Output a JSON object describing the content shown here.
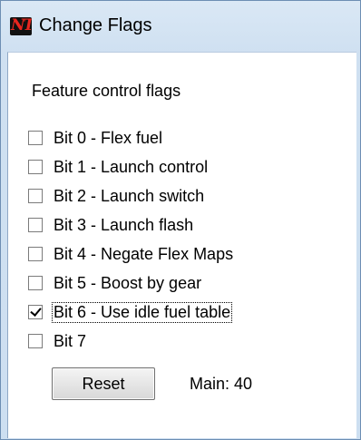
{
  "window": {
    "title": "Change Flags",
    "app_icon_text": "NT"
  },
  "panel": {
    "section_title": "Feature control flags",
    "flags": [
      {
        "label": "Bit 0 - Flex fuel",
        "checked": false
      },
      {
        "label": "Bit 1 - Launch control",
        "checked": false
      },
      {
        "label": "Bit 2 - Launch switch",
        "checked": false
      },
      {
        "label": "Bit 3 - Launch flash",
        "checked": false
      },
      {
        "label": "Bit 4 - Negate Flex Maps",
        "checked": false
      },
      {
        "label": "Bit 5 - Boost by gear",
        "checked": false
      },
      {
        "label": "Bit 6 - Use idle fuel table",
        "checked": true,
        "focused": true
      },
      {
        "label": "Bit 7",
        "checked": false
      }
    ],
    "reset_label": "Reset",
    "main_value": "Main: 40"
  }
}
